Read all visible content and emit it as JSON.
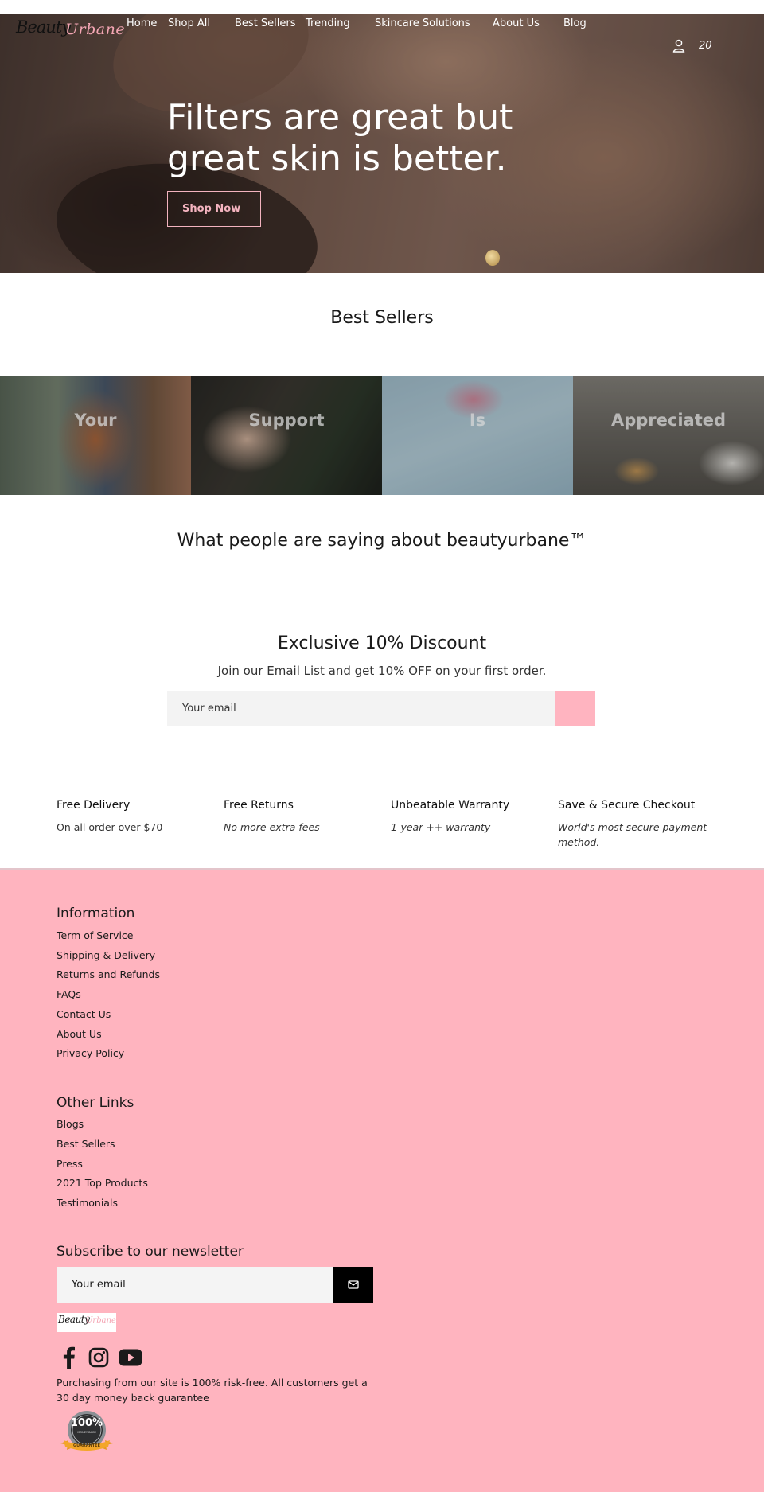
{
  "header": {
    "logo": {
      "part1": "Beauty",
      "part2": "Urbane"
    },
    "nav": [
      "Home",
      "Shop All",
      "Best Sellers",
      "Trending",
      "Skincare Solutions",
      "About Us",
      "Blog"
    ],
    "cart_count": "20",
    "icons": {
      "account": "user-icon",
      "cart": "cart-icon"
    }
  },
  "hero": {
    "title_line1": "Filters are great but",
    "title_line2": "great skin is better.",
    "button": "Shop Now"
  },
  "best_sellers": {
    "title": "Best Sellers",
    "tiles": [
      "Your",
      "Support",
      "Is",
      "Appreciated"
    ]
  },
  "testimonials": {
    "title": "What people are saying about beautyurbane™"
  },
  "discount": {
    "title": "Exclusive 10% Discount",
    "subtitle": "Join our Email List and get 10% OFF on your first order.",
    "email_placeholder": "Your email"
  },
  "features": [
    {
      "title": "Free Delivery",
      "text": "On all order over $70"
    },
    {
      "title": "Free Returns",
      "text": "No more extra fees"
    },
    {
      "title": "Unbeatable Warranty",
      "text": "1-year ++ warranty"
    },
    {
      "title": "Save & Secure Checkout",
      "text": "World's most secure payment method."
    }
  ],
  "footer": {
    "info_title": "Information",
    "info_links": [
      "Term of Service",
      "Shipping & Delivery",
      "Returns and Refunds",
      "FAQs",
      "Contact Us",
      "About Us",
      "Privacy Policy"
    ],
    "other_title": "Other Links",
    "other_links": [
      "Blogs",
      "Best Sellers",
      "Press",
      "2021 Top Products",
      "Testimonials"
    ],
    "newsletter_title": "Subscribe to our newsletter",
    "newsletter_placeholder": "Your email",
    "guarantee": "Purchasing from our site is 100% risk-free. All customers get a 30 day money back guarantee",
    "badge": {
      "percent": "100%",
      "top": "MONEY BACK",
      "bottom": "GUARANTEE"
    },
    "social_icons": [
      "facebook-icon",
      "instagram-icon",
      "youtube-icon"
    ]
  },
  "colors": {
    "accent_pink": "#ffb4bf",
    "hero_button": "#f3b3bf"
  }
}
